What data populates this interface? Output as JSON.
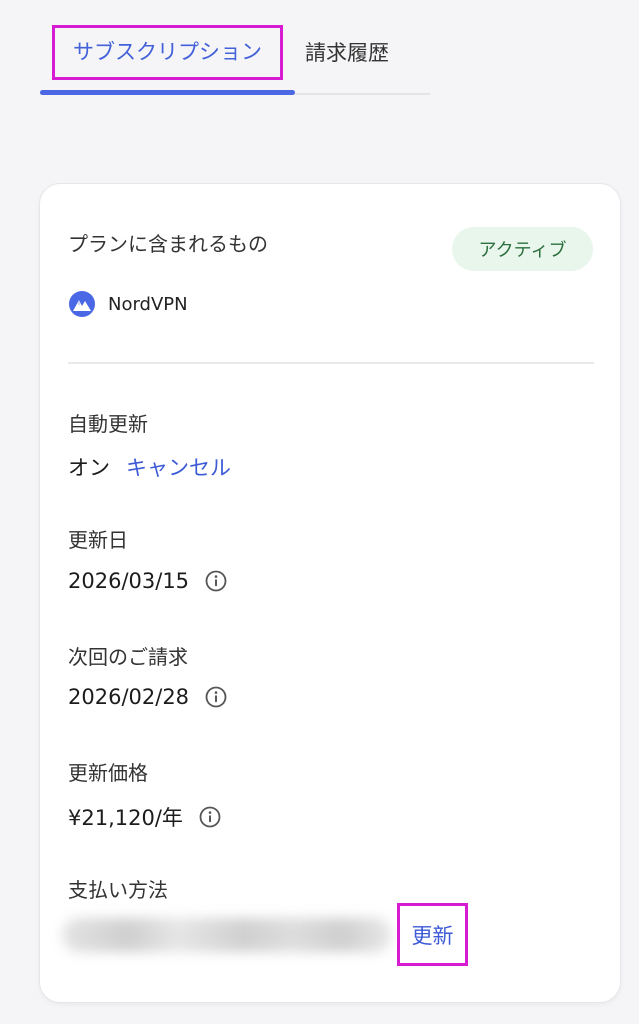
{
  "tabs": {
    "subscription": "サブスクリプション",
    "billing_history": "請求履歴"
  },
  "plan": {
    "label": "プランに含まれるもの",
    "status": "アクティブ",
    "product_icon": "nordvpn-logo-icon",
    "product_name": "NordVPN"
  },
  "auto_renewal": {
    "label": "自動更新",
    "value": "オン",
    "cancel_link": "キャンセル"
  },
  "renewal_date": {
    "label": "更新日",
    "value": "2026/03/15",
    "icon": "info-icon"
  },
  "next_billing": {
    "label": "次回のご請求",
    "value": "2026/02/28",
    "icon": "info-icon"
  },
  "renewal_price": {
    "label": "更新価格",
    "value": "¥21,120/年",
    "icon": "info-icon"
  },
  "payment": {
    "label": "支払い方法",
    "update_link": "更新"
  },
  "colors": {
    "accent": "#4c67e4",
    "link": "#3d5bd6",
    "highlight_box": "#d61bd3",
    "badge_bg": "#e8f6ec",
    "badge_text": "#2c6f3e"
  }
}
